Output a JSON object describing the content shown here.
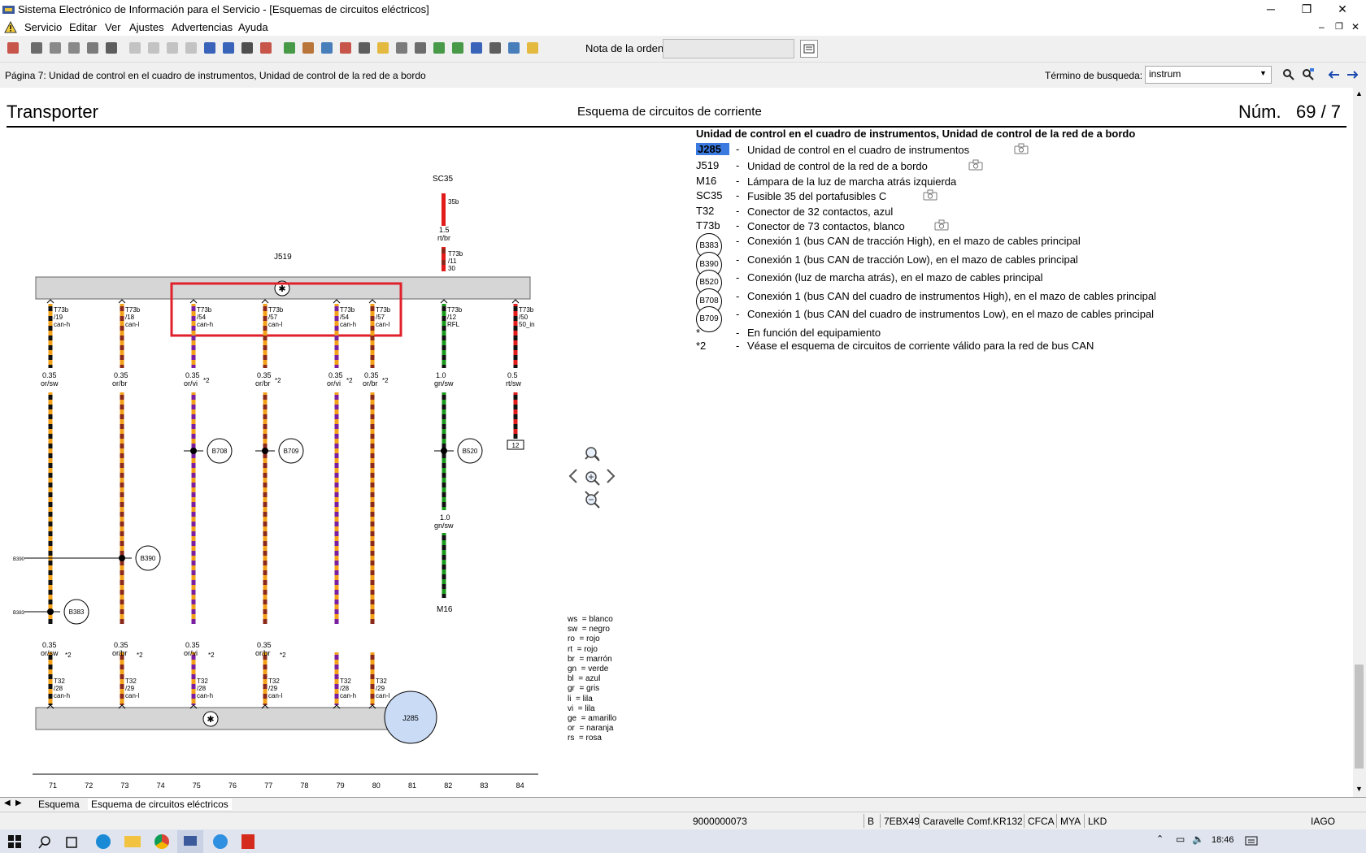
{
  "window": {
    "title": "Sistema Electrónico de Información para el Servicio - [Esquemas de circuitos eléctricos]",
    "minimize": "─",
    "restore": "❐",
    "close": "✕"
  },
  "menubar": {
    "items": [
      "Servicio",
      "Editar",
      "Ver",
      "Ajustes",
      "Advertencias",
      "Ayuda"
    ]
  },
  "toolbar": {
    "order_note_label": "Nota de la orden:",
    "order_note_value": "",
    "icons": [
      "exit-icon",
      "print-icon",
      "new-page-icon",
      "edit-icon",
      "document-icon",
      "car-icon",
      "first-icon",
      "prev-icon",
      "next-icon",
      "last-icon",
      "goto-icon",
      "info-icon",
      "help-icon",
      "switch-icon",
      "vehicle-icon",
      "calculator-icon",
      "parts-icon",
      "manual-icon",
      "list-icon",
      "warning-icon",
      "tools-icon",
      "form-icon",
      "book-icon",
      "car-green-icon",
      "search-car-icon",
      "checklist-icon",
      "diagnosis-icon",
      "question-icon"
    ]
  },
  "pagebar": {
    "page_title": "Página 7: Unidad de control en el cuadro de instrumentos, Unidad de control de la red de a bordo",
    "search_label": "Término de busqueda:",
    "search_value": "instrum"
  },
  "doc": {
    "model": "Transporter",
    "heading": "Esquema de circuitos de corriente",
    "num_label": "Núm.",
    "num_value": "69 / 7",
    "legend_title": "Unidad de control en el cuadro de instrumentos, Unidad de control de la red de a bordo",
    "components": [
      {
        "code": "J285",
        "desc": "Unidad de control en el cuadro de instrumentos",
        "camera": true,
        "highlight": true
      },
      {
        "code": "J519",
        "desc": "Unidad de control de la red de a bordo",
        "camera": true
      },
      {
        "code": "M16",
        "desc": "Lámpara de la luz de marcha atrás izquierda",
        "camera": false
      },
      {
        "code": "SC35",
        "desc": "Fusible 35 del portafusibles C",
        "camera": true
      },
      {
        "code": "T32",
        "desc": "Conector de 32 contactos, azul",
        "camera": false
      },
      {
        "code": "T73b",
        "desc": "Conector de 73 contactos, blanco",
        "camera": true
      }
    ],
    "connections": [
      {
        "code": "B383",
        "desc": "Conexión 1 (bus CAN de tracción High), en el mazo de cables principal"
      },
      {
        "code": "B390",
        "desc": "Conexión 1 (bus CAN de tracción Low), en el mazo de cables principal"
      },
      {
        "code": "B520",
        "desc": "Conexión (luz de marcha atrás), en el mazo de cables principal"
      },
      {
        "code": "B708",
        "desc": "Conexión 1 (bus CAN del cuadro de instrumentos High), en el mazo de cables principal"
      },
      {
        "code": "B709",
        "desc": "Conexión 1 (bus CAN del cuadro de instrumentos Low), en el mazo de cables principal"
      }
    ],
    "notes": [
      {
        "code": "*",
        "desc": "En función del equipamiento"
      },
      {
        "code": "*2",
        "desc": "Véase el esquema de circuitos de corriente válido para la red de bus CAN"
      }
    ],
    "colors": [
      "ws  = blanco",
      "sw  = negro",
      "ro  = rojo",
      "rt  = rojo",
      "br  = marrón",
      "gn  = verde",
      "bl  = azul",
      "gr  = gris",
      "li  = lila",
      "vi  = lila",
      "ge  = amarillo",
      "or  = naranja",
      "rs  = rosa"
    ],
    "diagram": {
      "fuse": "SC35",
      "fuse_pin": "35b",
      "fuse_wire": "1.5",
      "fuse_wire_color": "rt/br",
      "j519_label": "J519",
      "j285_label": "J285",
      "m16_label": "M16",
      "top_pin_extra": {
        "conn": "T73b",
        "pin": "/11",
        "sig": "30"
      },
      "columns": [
        "71",
        "72",
        "73",
        "74",
        "75",
        "76",
        "77",
        "78",
        "79",
        "80",
        "81",
        "82",
        "83",
        "84"
      ],
      "side_labels": [
        "B390",
        "B383"
      ],
      "ground_box": "12",
      "wires": [
        {
          "conn": "T73b",
          "pin": "/19",
          "sig": "can-h",
          "gauge": "0.35",
          "color": "or/sw",
          "c1": "#f4a11a",
          "c2": "#111",
          "node": "B383",
          "bconn": "T32",
          "bpin": "/28",
          "bsig": "can-h",
          "star": ""
        },
        {
          "conn": "T73b",
          "pin": "/18",
          "sig": "can-l",
          "gauge": "0.35",
          "color": "or/br",
          "c1": "#f4a11a",
          "c2": "#8b2a1a",
          "node": "B390",
          "bconn": "T32",
          "bpin": "/29",
          "bsig": "can-l",
          "star": "*2"
        },
        {
          "conn": "T73b",
          "pin": "/54",
          "sig": "can-h",
          "gauge": "0.35",
          "color": "or/vi",
          "c1": "#f4a11a",
          "c2": "#7a1fa0",
          "node": "B708",
          "bconn": "T32",
          "bpin": "/28",
          "bsig": "can-h",
          "star": "*2"
        },
        {
          "conn": "T73b",
          "pin": "/57",
          "sig": "can-l",
          "gauge": "0.35",
          "color": "or/br",
          "c1": "#f4a11a",
          "c2": "#8b2a1a",
          "node": "B709",
          "bconn": "T32",
          "bpin": "/29",
          "bsig": "can-l",
          "star": "*2"
        },
        {
          "conn": "T73b",
          "pin": "/54",
          "sig": "can-h",
          "gauge": "0.35",
          "color": "or/vi",
          "c1": "#f4a11a",
          "c2": "#7a1fa0",
          "node": "",
          "bconn": "T32",
          "bpin": "/28",
          "bsig": "can-h",
          "star": "*2"
        },
        {
          "conn": "T73b",
          "pin": "/57",
          "sig": "can-l",
          "gauge": "0.35",
          "color": "or/br",
          "c1": "#f4a11a",
          "c2": "#8b2a1a",
          "node": "",
          "bconn": "T32",
          "bpin": "/29",
          "bsig": "can-l",
          "star": "*2"
        },
        {
          "conn": "T73b",
          "pin": "/12",
          "sig": "RFL",
          "gauge": "1.0",
          "color": "gn/sw",
          "c1": "#1a9a1a",
          "c2": "#111",
          "node": "B520",
          "gauge2": "1.0",
          "color2": "gn/sw",
          "bconn": "",
          "bpin": "",
          "bsig": "",
          "star": ""
        },
        {
          "conn": "T73b",
          "pin": "/50",
          "sig": "50_in",
          "gauge": "0.5",
          "color": "rt/sw",
          "c1": "#e21b1b",
          "c2": "#111",
          "node": "",
          "bconn": "",
          "bpin": "",
          "bsig": "",
          "star": ""
        }
      ],
      "bottom_gauges": [
        {
          "gauge": "0.35",
          "color": "or/sw",
          "star": "*2"
        },
        {
          "gauge": "0.35",
          "color": "or/br",
          "star": "*2"
        },
        {
          "gauge": "0.35",
          "color": "or/vi",
          "star": "*2"
        },
        {
          "gauge": "0.35",
          "color": "or/br",
          "star": "*2"
        }
      ]
    }
  },
  "tabs": {
    "items": [
      "Esquema",
      "Esquema de circuitos eléctricos"
    ],
    "active": 1
  },
  "statusbar": {
    "order_no": "9000000073",
    "cells": [
      "B",
      "7EBX49",
      "Caravelle Comf.KR132",
      "CFCA",
      "MYA",
      "LKD"
    ],
    "user": "IAGO"
  },
  "taskbar": {
    "time": "18:46"
  },
  "accent": {
    "highlight": "#3b7be0",
    "red_box": "#e0202a"
  }
}
